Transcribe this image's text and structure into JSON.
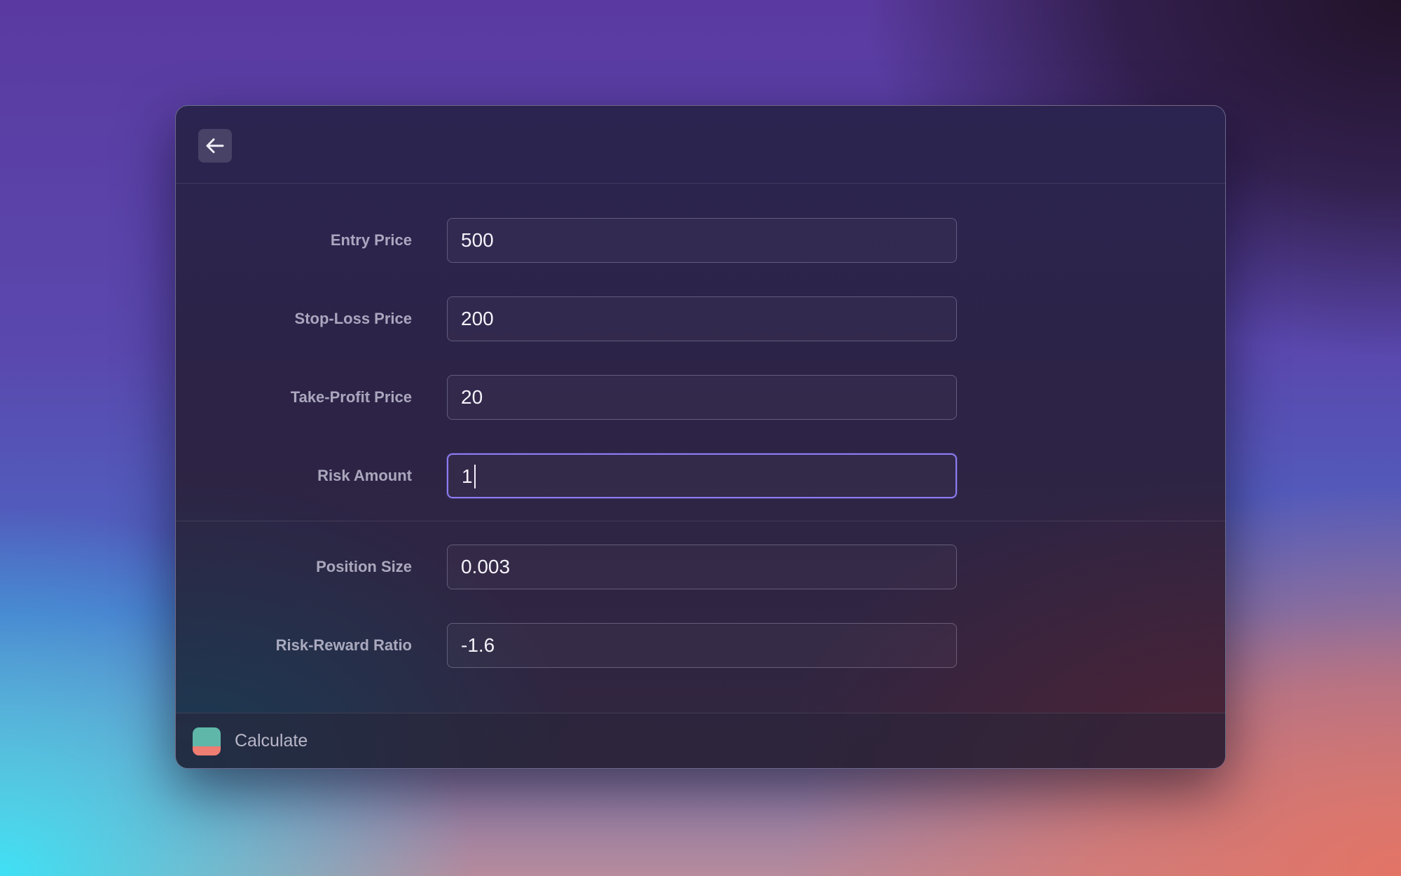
{
  "window": {
    "back_icon": "arrow-left-icon"
  },
  "form": {
    "inputs": [
      {
        "label": "Entry Price",
        "value": "500"
      },
      {
        "label": "Stop-Loss Price",
        "value": "200"
      },
      {
        "label": "Take-Profit Price",
        "value": "20"
      },
      {
        "label": "Risk Amount",
        "value": "1"
      }
    ],
    "results": [
      {
        "label": "Position Size",
        "value": "0.003"
      },
      {
        "label": "Risk-Reward Ratio",
        "value": "-1.6"
      }
    ]
  },
  "footer": {
    "action_label": "Calculate",
    "app_icon": "app-icon"
  },
  "colors": {
    "focus_ring": "#8c7cf2",
    "app_icon_top": "#5fb7a9",
    "app_icon_bottom": "#ee7d72"
  }
}
